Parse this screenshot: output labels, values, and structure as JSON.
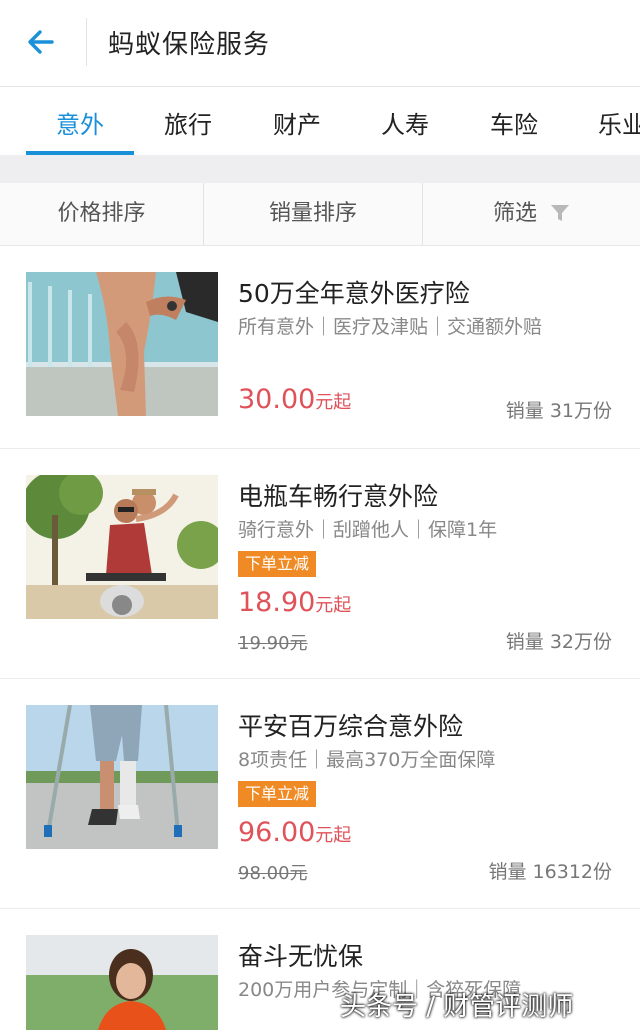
{
  "header": {
    "title": "蚂蚁保险服务"
  },
  "tabs": [
    {
      "label": "意外"
    },
    {
      "label": "旅行"
    },
    {
      "label": "财产"
    },
    {
      "label": "人寿"
    },
    {
      "label": "车险"
    },
    {
      "label": "乐业"
    }
  ],
  "sort": {
    "price": "价格排序",
    "sales": "销量排序",
    "filter": "筛选"
  },
  "products": [
    {
      "title": "50万全年意外医疗险",
      "tags": "所有意外｜医疗及津贴｜交通额外赔",
      "price": "30.00",
      "price_suffix": "元起",
      "sales": "销量 31万份"
    },
    {
      "title": "电瓶车畅行意外险",
      "tags": "骑行意外｜刮蹭他人｜保障1年",
      "badge": "下单立减",
      "price": "18.90",
      "price_suffix": "元起",
      "original_price": "19.90元",
      "sales": "销量 32万份"
    },
    {
      "title": "平安百万综合意外险",
      "tags": "8项责任｜最高370万全面保障",
      "badge": "下单立减",
      "price": "96.00",
      "price_suffix": "元起",
      "original_price": "98.00元",
      "sales": "销量 16312份"
    },
    {
      "title": "奋斗无忧保",
      "tags": "200万用户参与定制｜含猝死保障"
    }
  ],
  "watermark": "头条号 / 财管评测师",
  "colors": {
    "accent": "#1a90d9",
    "price": "#e0525a",
    "badge": "#f08a24"
  }
}
